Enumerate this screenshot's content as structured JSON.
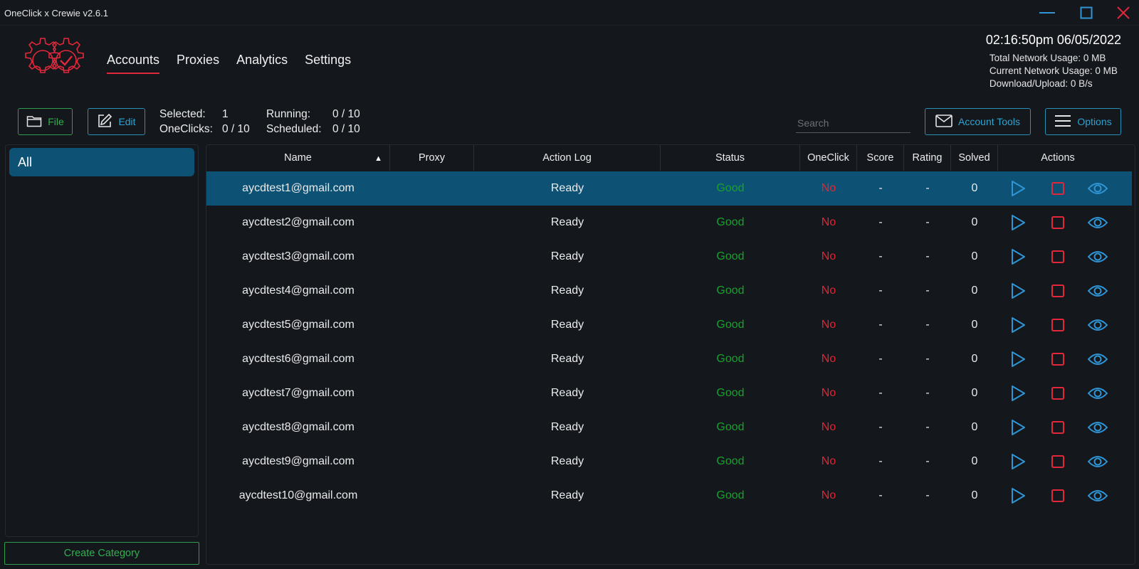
{
  "window": {
    "title": "OneClick x Crewie v2.6.1",
    "controls": [
      "minimize-icon",
      "maximize-icon",
      "close-icon"
    ]
  },
  "colors": {
    "accent_red": "#e0283a",
    "accent_blue": "#2fa3d1",
    "accent_green": "#30b04f",
    "selected_row": "#0d5274",
    "background": "#14171c"
  },
  "nav": {
    "tabs": [
      "Accounts",
      "Proxies",
      "Analytics",
      "Settings"
    ],
    "active": "Accounts"
  },
  "header": {
    "datetime": "02:16:50pm 06/05/2022",
    "total_network": "Total Network Usage:  0 MB",
    "current_network": "Current Network Usage: 0 MB",
    "download_upload": "Download/Upload: 0 B/s"
  },
  "toolbar": {
    "file_label": "File",
    "edit_label": "Edit",
    "selected_label": "Selected:",
    "selected_value": "1",
    "running_label": "Running:",
    "running_value": "0 / 10",
    "oneclicks_label": "OneClicks:",
    "oneclicks_value": "0 / 10",
    "scheduled_label": "Scheduled:",
    "scheduled_value": "0 / 10",
    "search_placeholder": "Search",
    "account_tools_label": "Account Tools",
    "options_label": "Options"
  },
  "sidebar": {
    "categories": [
      "All"
    ],
    "create_label": "Create Category"
  },
  "table": {
    "columns": [
      "Name",
      "Proxy",
      "Action Log",
      "Status",
      "OneClick",
      "Score",
      "Rating",
      "Solved",
      "Actions"
    ],
    "sorted_by": "Name",
    "rows": [
      {
        "name": "aycdtest1@gmail.com",
        "proxy": "",
        "log": "Ready",
        "status": "Good",
        "oneclick": "No",
        "score": "-",
        "rating": "-",
        "solved": "0",
        "selected": true
      },
      {
        "name": "aycdtest2@gmail.com",
        "proxy": "",
        "log": "Ready",
        "status": "Good",
        "oneclick": "No",
        "score": "-",
        "rating": "-",
        "solved": "0"
      },
      {
        "name": "aycdtest3@gmail.com",
        "proxy": "",
        "log": "Ready",
        "status": "Good",
        "oneclick": "No",
        "score": "-",
        "rating": "-",
        "solved": "0"
      },
      {
        "name": "aycdtest4@gmail.com",
        "proxy": "",
        "log": "Ready",
        "status": "Good",
        "oneclick": "No",
        "score": "-",
        "rating": "-",
        "solved": "0"
      },
      {
        "name": "aycdtest5@gmail.com",
        "proxy": "",
        "log": "Ready",
        "status": "Good",
        "oneclick": "No",
        "score": "-",
        "rating": "-",
        "solved": "0"
      },
      {
        "name": "aycdtest6@gmail.com",
        "proxy": "",
        "log": "Ready",
        "status": "Good",
        "oneclick": "No",
        "score": "-",
        "rating": "-",
        "solved": "0"
      },
      {
        "name": "aycdtest7@gmail.com",
        "proxy": "",
        "log": "Ready",
        "status": "Good",
        "oneclick": "No",
        "score": "-",
        "rating": "-",
        "solved": "0"
      },
      {
        "name": "aycdtest8@gmail.com",
        "proxy": "",
        "log": "Ready",
        "status": "Good",
        "oneclick": "No",
        "score": "-",
        "rating": "-",
        "solved": "0"
      },
      {
        "name": "aycdtest9@gmail.com",
        "proxy": "",
        "log": "Ready",
        "status": "Good",
        "oneclick": "No",
        "score": "-",
        "rating": "-",
        "solved": "0"
      },
      {
        "name": "aycdtest10@gmail.com",
        "proxy": "",
        "log": "Ready",
        "status": "Good",
        "oneclick": "No",
        "score": "-",
        "rating": "-",
        "solved": "0"
      }
    ],
    "row_actions": [
      "play-icon",
      "stop-icon",
      "eye-icon"
    ]
  }
}
